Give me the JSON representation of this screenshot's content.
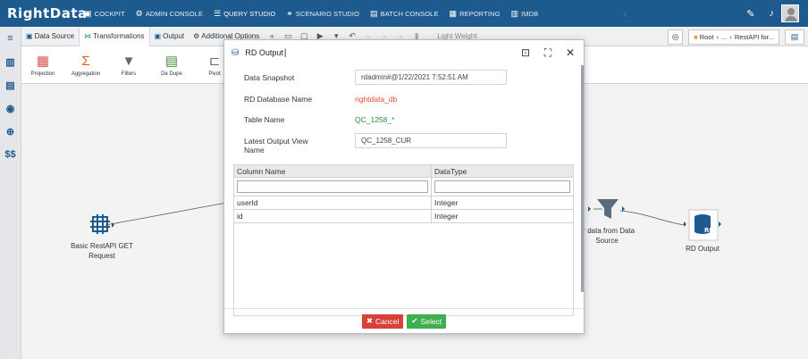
{
  "app": {
    "logo": "RightData",
    "nav": [
      {
        "icon": "cockpit-icon",
        "label": "COCKPIT"
      },
      {
        "icon": "admin-console-icon",
        "label": "ADMIN CONSOLE"
      },
      {
        "icon": "query-studio-icon",
        "label": "QUERY STUDIO"
      },
      {
        "icon": "scenario-studio-icon",
        "label": "SCENARIO STUDIO"
      },
      {
        "icon": "batch-console-icon",
        "label": "BATCH CONSOLE"
      },
      {
        "icon": "reporting-icon",
        "label": "REPORTING"
      },
      {
        "icon": "imdb-icon",
        "label": "IMDB"
      }
    ]
  },
  "tabs": [
    {
      "label": "Data Source"
    },
    {
      "label": "Transformations"
    },
    {
      "label": "Output"
    },
    {
      "label": "Additional Options"
    }
  ],
  "toolbar": {
    "lightweight_label": "Light Weight",
    "breadcrumb_root": "Root",
    "breadcrumb_ellipsis": "...",
    "breadcrumb_item": "RestAPI for..."
  },
  "ribbon": [
    {
      "label": "Projection",
      "color": "#d9534f"
    },
    {
      "label": "Aggregation",
      "color": "#e05a24"
    },
    {
      "label": "Filters",
      "color": "#5a6b7b"
    },
    {
      "label": "De Dupe",
      "color": "#4a8a3c"
    },
    {
      "label": "Pivot",
      "color": "#6a6a6a"
    }
  ],
  "canvas": {
    "nodes": [
      {
        "label_line1": "Basic RestAPI GET",
        "label_line2": "Request"
      },
      {
        "label_line1": "er data from Data",
        "label_line2": "Source"
      },
      {
        "label_line1": "RD Output",
        "label_line2": ""
      }
    ]
  },
  "modal": {
    "title": "RD Output",
    "fields": {
      "data_snapshot_label": "Data Snapshot",
      "data_snapshot_value": "rdadmin#@1/22/2021 7:52:51 AM",
      "db_name_label": "RD Database Name",
      "db_name_value": "rightdata_db",
      "table_name_label": "Table Name",
      "table_name_value": "QC_1258_*",
      "latest_view_label_1": "Latest Output View",
      "latest_view_label_2": "Name",
      "latest_view_value": "QC_1258_CUR"
    },
    "grid": {
      "columns": [
        "Column Name",
        "DataType"
      ],
      "rows": [
        [
          "userId",
          "Integer"
        ],
        [
          "id",
          "Integer"
        ]
      ]
    },
    "cancel_label": "Cancel",
    "select_label": "Select"
  },
  "colors": {
    "nav_bg": "#1d5a8e",
    "db_name": "#e34b2a",
    "table_name": "#2e8b3d",
    "cancel": "#d9403a",
    "select": "#3fae4f"
  }
}
